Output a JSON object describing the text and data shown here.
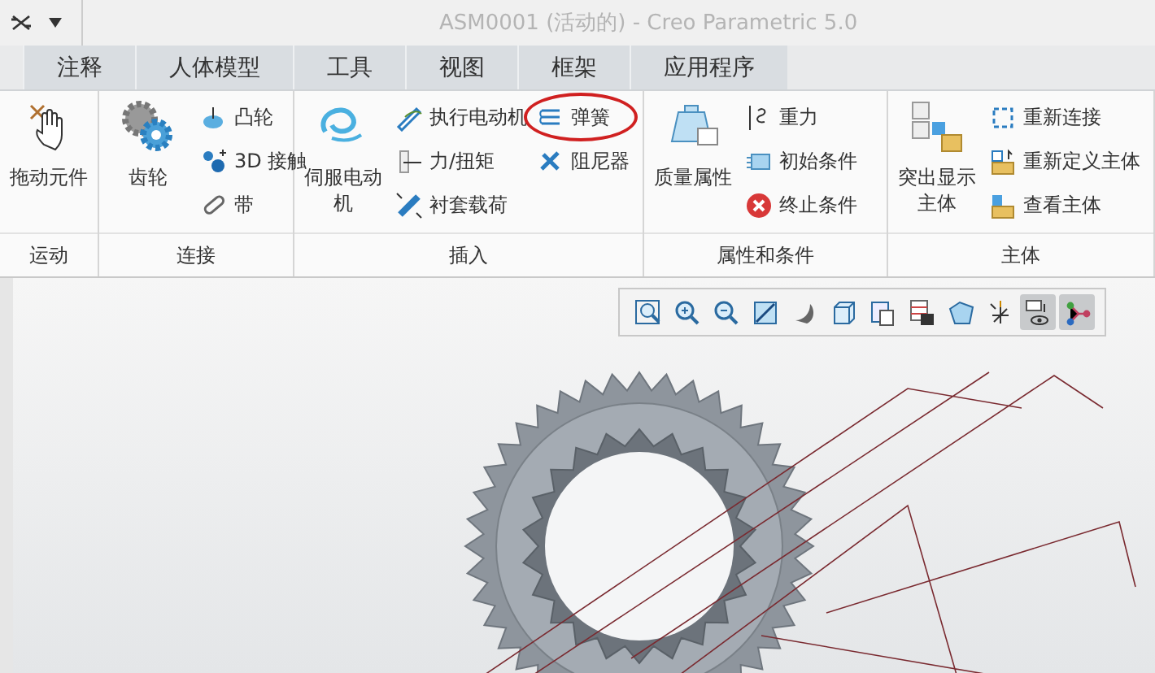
{
  "title_bar": {
    "title": "ASM0001 (活动的) - Creo Parametric 5.0"
  },
  "tabs": [
    {
      "label": "注释",
      "selected": false
    },
    {
      "label": "人体模型",
      "selected": false
    },
    {
      "label": "工具",
      "selected": false
    },
    {
      "label": "视图",
      "selected": false
    },
    {
      "label": "框架",
      "selected": false
    },
    {
      "label": "应用程序",
      "selected": false
    }
  ],
  "ribbon": {
    "groups": [
      {
        "label": "运动",
        "columns": [
          [
            {
              "label": "拖动元件",
              "kind": "large",
              "circled": false
            }
          ]
        ]
      },
      {
        "label": "连接",
        "columns": [
          [
            {
              "label": "齿轮",
              "kind": "large",
              "circled": false
            }
          ],
          [
            {
              "label": "凸轮",
              "kind": "small",
              "circled": false
            },
            {
              "label": "3D 接触",
              "kind": "small",
              "circled": false
            },
            {
              "label": "带",
              "kind": "small",
              "circled": false
            }
          ]
        ]
      },
      {
        "label": "插入",
        "columns": [
          [
            {
              "label": "伺服电动机",
              "kind": "large",
              "circled": false
            }
          ],
          [
            {
              "label": "执行电动机",
              "kind": "small",
              "circled": false
            },
            {
              "label": "力/扭矩",
              "kind": "small",
              "circled": false
            },
            {
              "label": "衬套载荷",
              "kind": "small",
              "circled": false
            }
          ],
          [
            {
              "label": "弹簧",
              "kind": "small",
              "circled": true
            },
            {
              "label": "阻尼器",
              "kind": "small",
              "circled": false
            }
          ]
        ]
      },
      {
        "label": "属性和条件",
        "columns": [
          [
            {
              "label": "质量属性",
              "kind": "large",
              "circled": false
            }
          ],
          [
            {
              "label": "重力",
              "kind": "small",
              "circled": false
            },
            {
              "label": "初始条件",
              "kind": "small",
              "circled": false
            },
            {
              "label": "终止条件",
              "kind": "small",
              "circled": false
            }
          ]
        ]
      },
      {
        "label": "主体",
        "columns": [
          [
            {
              "label": "突出显示主体",
              "kind": "large",
              "circled": false
            }
          ],
          [
            {
              "label": "重新连接",
              "kind": "small",
              "circled": false
            },
            {
              "label": "重新定义主体",
              "kind": "small",
              "circled": false
            },
            {
              "label": "查看主体",
              "kind": "small",
              "circled": false
            }
          ]
        ]
      }
    ]
  },
  "view_toolbar": {
    "buttons": [
      {
        "selected": false
      },
      {
        "selected": false
      },
      {
        "selected": false
      },
      {
        "selected": false
      },
      {
        "selected": false
      },
      {
        "selected": false
      },
      {
        "selected": false
      },
      {
        "selected": false
      },
      {
        "selected": false
      },
      {
        "selected": false
      },
      {
        "selected": true
      },
      {
        "selected": true
      }
    ]
  }
}
